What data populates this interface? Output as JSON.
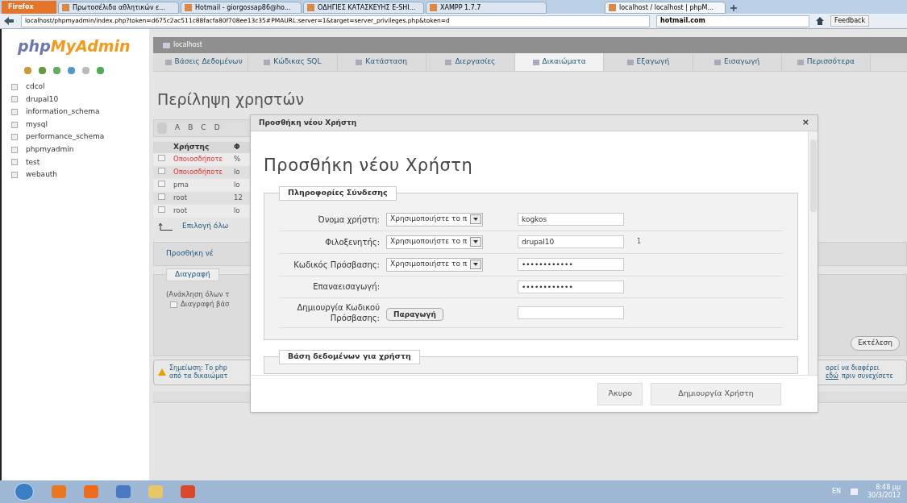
{
  "browser": {
    "firefox_button": "Firefox",
    "tabs": [
      {
        "label": "Πρωτοσέλιδα αθλητικών ε...",
        "selected": false
      },
      {
        "label": "Hotmail - giorgossap86@ho...",
        "selected": false
      },
      {
        "label": "ΟΔΗΓΙΕΣ ΚΑΤΑΣΚΕΥΗΣ E-SHI...",
        "selected": false
      },
      {
        "label": "XAMPP 1.7.7",
        "selected": false
      },
      {
        "label": "localhost / localhost | phpM...",
        "selected": true
      }
    ],
    "url": "localhost/phpmyadmin/index.php?token=d675c2ac511c88facfa80f708ee13c35#PMAURL:server=1&target=server_privileges.php&token=d",
    "search": "hotmail.com",
    "feedback": "Feedback"
  },
  "sidebar": {
    "logo_php": "php",
    "logo_myadmin": "MyAdmin",
    "databases": [
      "cdcol",
      "drupal10",
      "information_schema",
      "mysql",
      "performance_schema",
      "phpmyadmin",
      "test",
      "webauth"
    ]
  },
  "server_bar": {
    "title": "localhost"
  },
  "tabs": [
    {
      "label": "Βάσεις Δεδομένων",
      "selected": false
    },
    {
      "label": "Κώδικας SQL",
      "selected": false
    },
    {
      "label": "Κατάσταση",
      "selected": false
    },
    {
      "label": "Διεργασίες",
      "selected": false
    },
    {
      "label": "Δικαιώματα",
      "selected": true
    },
    {
      "label": "Εξαγωγή",
      "selected": false
    },
    {
      "label": "Εισαγωγή",
      "selected": false
    },
    {
      "label": "Περισσότερα",
      "selected": false
    }
  ],
  "page_title": "Περίληψη χρηστών",
  "background": {
    "alphabet": [
      "A",
      "B",
      "C",
      "D"
    ],
    "columns": [
      "Χρήστης",
      "Φ"
    ],
    "rows": [
      {
        "user": "Οποιοσδήποτε",
        "host": "%",
        "anonymous": true,
        "checked": false
      },
      {
        "user": "Οποιοσδήποτε",
        "host": "lo",
        "anonymous": true,
        "checked": false
      },
      {
        "user": "pma",
        "host": "lo",
        "anonymous": false,
        "checked": false
      },
      {
        "user": "root",
        "host": "12",
        "anonymous": false,
        "checked": false
      },
      {
        "user": "root",
        "host": "lo",
        "anonymous": false,
        "checked": false
      }
    ],
    "select_all": "Επιλογή όλω",
    "add_user": "Προσθήκη νέ",
    "delete_legend": "Διαγραφή",
    "revoke_text": "(Ανάκληση όλων τ",
    "drop_db_label": "Διαγραφή βάσ",
    "drop_db_checked": false,
    "execute": "Εκτέλεση",
    "note_left": [
      "Σημείωση: Το php",
      "από τα δικαιώματ"
    ],
    "note_right_1": "ορεί να διαφέρει",
    "note_link": "εδώ",
    "note_right_2": "πριν συνεχίσετε"
  },
  "dialog": {
    "title": "Προσθήκη νέου Χρήστη",
    "close": "×",
    "heading": "Προσθήκη νέου Χρήστη",
    "login_legend": "Πληροφορίες Σύνδεσης",
    "fields": [
      {
        "kind": "select_input",
        "label": "Όνομα χρήστη:",
        "select": "Χρησιμοποιήστε το π",
        "value": "kogkos"
      },
      {
        "kind": "select_input",
        "label": "Φιλοξενητής:",
        "select": "Χρησιμοποιήστε το π",
        "value": "drupal10",
        "note": "1"
      },
      {
        "kind": "select_input",
        "label": "Κωδικός Πρόσβασης:",
        "select": "Χρησιμοποιήστε το π",
        "value": "••••••••••••"
      },
      {
        "kind": "input",
        "label": "Επαναεισαγωγή:",
        "value": "••••••••••••"
      },
      {
        "kind": "button_input",
        "label": "Δημιουργία Κωδικού Πρόσβασης:",
        "button": "Παραγωγή"
      }
    ],
    "db_legend": "Βάση δεδομένων για χρήστη",
    "cancel": "Άκυρο",
    "create": "Δημιουργία Χρήστη"
  },
  "taskbar": {
    "language": "EN",
    "time": "8:48 μμ",
    "date": "30/3/2012"
  }
}
